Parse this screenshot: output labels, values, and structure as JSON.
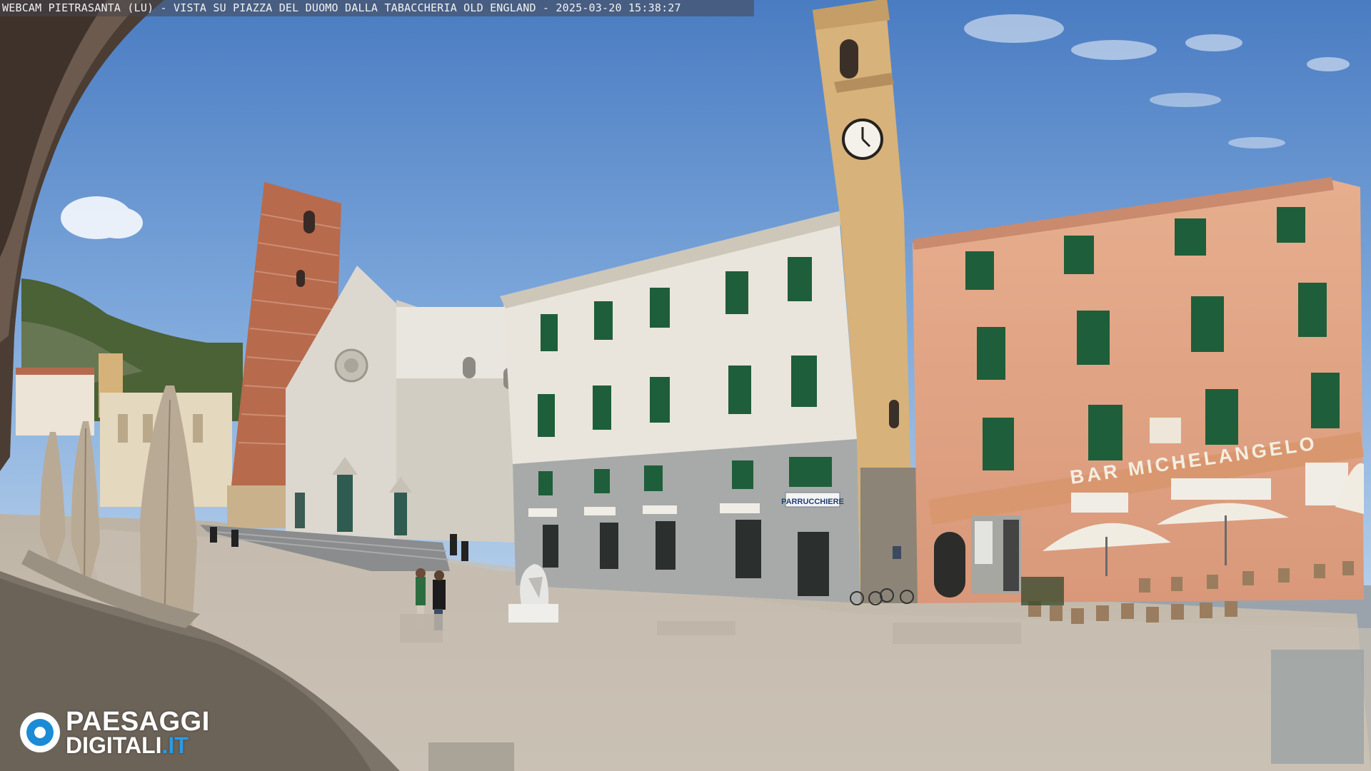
{
  "caption": "WEBCAM PIETRASANTA (LU) - VISTA SU PIAZZA DEL DUOMO DALLA TABACCHERIA OLD ENGLAND - 2025-03-20 15:38:27",
  "logo": {
    "line1": "PAESAGGI",
    "line2": "DIGITALI",
    "line2_suffix": ".IT",
    "accent": "#1b8bd6",
    "icon": "camera-lens-icon"
  },
  "scene": {
    "bar_sign": "BAR MICHELANGELO",
    "shop_sign": "PARRUCCHIERE",
    "colors": {
      "sky_top": "#4d7fc4",
      "sky_bottom": "#9cc0e8",
      "piazza": "#c6bdb0",
      "cathedral_marble": "#dcd8d0",
      "bell_tower_brick": "#b86a4c",
      "white_palazzo": "#e9e5dc",
      "clock_tower": "#d7b27a",
      "pink_palazzo": "#e2a584",
      "shutter_green": "#1f5e3a",
      "umbrella": "#b9aa95"
    }
  }
}
